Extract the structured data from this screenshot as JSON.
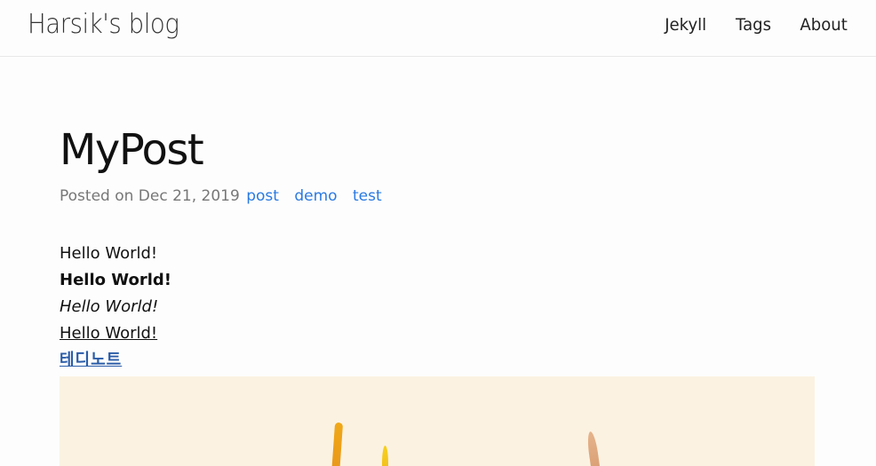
{
  "header": {
    "site_title": "Harsik's blog",
    "nav": [
      "Jekyll",
      "Tags",
      "About"
    ]
  },
  "post": {
    "title": "MyPost",
    "meta_prefix": "Posted on Dec 21, 2019",
    "tags": [
      "post",
      "demo",
      "test"
    ],
    "content": {
      "line_plain": "Hello World!",
      "line_bold": "Hello World!",
      "line_italic": "Hello World!",
      "line_underline": "Hello World!",
      "link_text": "테디노트"
    }
  },
  "colors": {
    "link": "#2a7ae2",
    "korean_link": "#2a5ca8",
    "image_bg": "#fbf2e2"
  }
}
